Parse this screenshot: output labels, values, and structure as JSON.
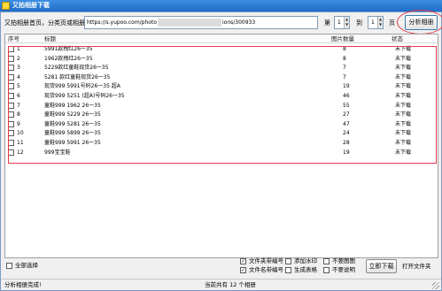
{
  "window": {
    "title": "又拍相册下载"
  },
  "toolbar": {
    "url_label": "又拍相册首页，分类页或相册页：",
    "url_prefix": "https://s.yupoo.com/photo",
    "url_suffix": "ions/300933",
    "page_label": "第",
    "page_from": "1",
    "to_label": "到",
    "page_to": "1",
    "page_unit": "页",
    "analyze_button": "分析相册"
  },
  "table": {
    "headers": {
      "index": "序号",
      "title": "标题",
      "count": "图片数量",
      "status": "状态"
    },
    "rows": [
      {
        "index": "1",
        "title": "5991款拽红26一35",
        "count": "8",
        "status": "未下载"
      },
      {
        "index": "2",
        "title": "1962款拽红26一35",
        "count": "8",
        "status": "未下载"
      },
      {
        "index": "3",
        "title": "5229款红童鞋现货26一35",
        "count": "7",
        "status": "未下载"
      },
      {
        "index": "4",
        "title": "5281 款红童鞋现货26一35",
        "count": "7",
        "status": "未下载"
      },
      {
        "index": "5",
        "title": "现货999 5991号码26一35 超A",
        "count": "19",
        "status": "未下载"
      },
      {
        "index": "6",
        "title": "现货999 5251 (超A)号码26一35",
        "count": "46",
        "status": "未下载"
      },
      {
        "index": "7",
        "title": "童鞋999 1962 26一35",
        "count": "55",
        "status": "未下载"
      },
      {
        "index": "8",
        "title": "童鞋999 5229 26一35",
        "count": "27",
        "status": "未下载"
      },
      {
        "index": "9",
        "title": "童鞋999 5281 26一35",
        "count": "47",
        "status": "未下载"
      },
      {
        "index": "10",
        "title": "童鞋999 5899 26一35",
        "count": "24",
        "status": "未下载"
      },
      {
        "index": "11",
        "title": "童鞋999 5991 26一35",
        "count": "28",
        "status": "未下载"
      },
      {
        "index": "12",
        "title": "999宝宝鞋",
        "count": "19",
        "status": "未下载"
      }
    ]
  },
  "options": {
    "select_all": "全部选择",
    "file_seq": "文件夹带编号",
    "file_name_seq": "文件名带编号",
    "add_watermark": "添加水印",
    "generate_table": "生成表格",
    "no_main_image": "不要图图",
    "no_description": "不要说明"
  },
  "actions": {
    "download": "立即下载",
    "open_folder": "打开文件夹"
  },
  "status": {
    "left": "分析相册完成!",
    "middle": "当前共有 12 个相册"
  }
}
